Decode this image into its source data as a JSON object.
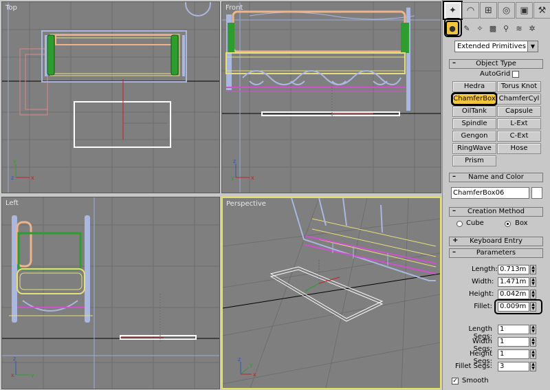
{
  "viewports": {
    "top": "Top",
    "front": "Front",
    "left": "Left",
    "perspective": "Perspective"
  },
  "axis": {
    "x": "x",
    "y": "y",
    "z": "z"
  },
  "panel": {
    "tabs": [
      "create-tab",
      "modify-tab",
      "hierarchy-tab",
      "motion-tab",
      "display-tab",
      "utilities-tab"
    ],
    "subicons": [
      "geometry-icon",
      "shapes-icon",
      "lights-icon",
      "cameras-icon",
      "helpers-icon",
      "spacewarps-icon",
      "systems-icon"
    ],
    "category": "Extended Primitives",
    "object_type": {
      "title": "Object Type",
      "autogrid": "AutoGrid",
      "buttons": [
        "Hedra",
        "Torus Knot",
        "ChamferBox",
        "ChamferCyl",
        "OilTank",
        "Capsule",
        "Spindle",
        "L-Ext",
        "Gengon",
        "C-Ext",
        "RingWave",
        "Hose",
        "Prism"
      ]
    },
    "name_color": {
      "title": "Name and Color",
      "name": "ChamferBox06"
    },
    "creation_method": {
      "title": "Creation Method",
      "cube": "Cube",
      "box": "Box"
    },
    "keyboard_entry": {
      "title": "Keyboard Entry"
    },
    "parameters": {
      "title": "Parameters",
      "length_label": "Length:",
      "length": "0.713m",
      "width_label": "Width:",
      "width": "1.471m",
      "height_label": "Height:",
      "height": "0.042m",
      "fillet_label": "Fillet:",
      "fillet": "0.009m",
      "length_segs_label": "Length Segs:",
      "length_segs": "1",
      "width_segs_label": "Width Segs:",
      "width_segs": "1",
      "height_segs_label": "Height Segs:",
      "height_segs": "1",
      "fillet_segs_label": "Fillet Segs:",
      "fillet_segs": "3",
      "smooth": "Smooth"
    }
  }
}
